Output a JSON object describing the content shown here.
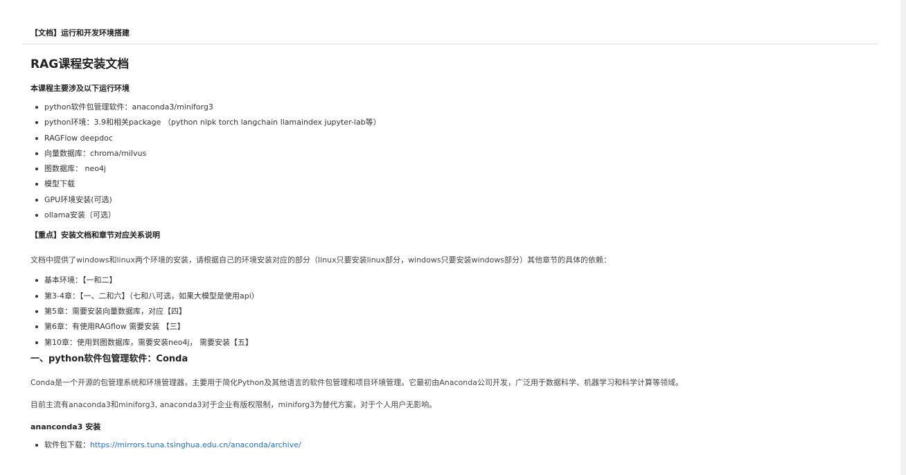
{
  "header": {
    "title": "【文档】运行和开发环境搭建"
  },
  "doc": {
    "title": "RAG课程安装文档",
    "intro": "本课程主要涉及以下运行环境",
    "env_items": [
      "python软件包管理软件：anaconda3/miniforg3",
      "python环境：3.9和相关package （python nlpk torch langchain llamaindex jupyter-lab等）",
      "RAGFlow deepdoc",
      "向量数据库：chroma/milvus",
      "图数据库： neo4j",
      "模型下载",
      "GPU环境安装(可选)",
      "ollama安装（可选）"
    ],
    "key_heading": "【重点】安装文档和章节对应关系说明",
    "key_para": "文档中提供了windows和linux两个环境的安装，请根据自己的环境安装对应的部分（linux只要安装linux部分，windows只要安装windows部分）其他章节的具体的依赖：",
    "chapter_items": [
      "基本环境：【一和二】",
      "第3-4章：【一、二和六】（七和八可选，如果大模型是使用api）",
      "第5章：需要安装向量数据库，对应【四】",
      "第6章：有使用RAGflow 需要安装 【三】",
      "第10章：使用到图数据库，需要安装neo4j， 需要安装【五】"
    ],
    "section1_title": "一、python软件包管理软件：Conda",
    "section1_para1": "Conda是一个开源的包管理系统和环境管理器，主要用于简化Python及其他语言的软件包管理和项目环境管理。它最初由Anaconda公司开发，广泛用于数据科学、机器学习和科学计算等领域。",
    "section1_para2": "目前主流有anaconda3和miniforg3, anaconda3对于企业有版权限制，miniforg3为替代方案，对于个人用户无影响。",
    "anaconda_heading": "ananconda3 安装",
    "download_label": "软件包下载：",
    "download_link": "https://mirrors.tuna.tsinghua.edu.cn/anaconda/archive/"
  }
}
